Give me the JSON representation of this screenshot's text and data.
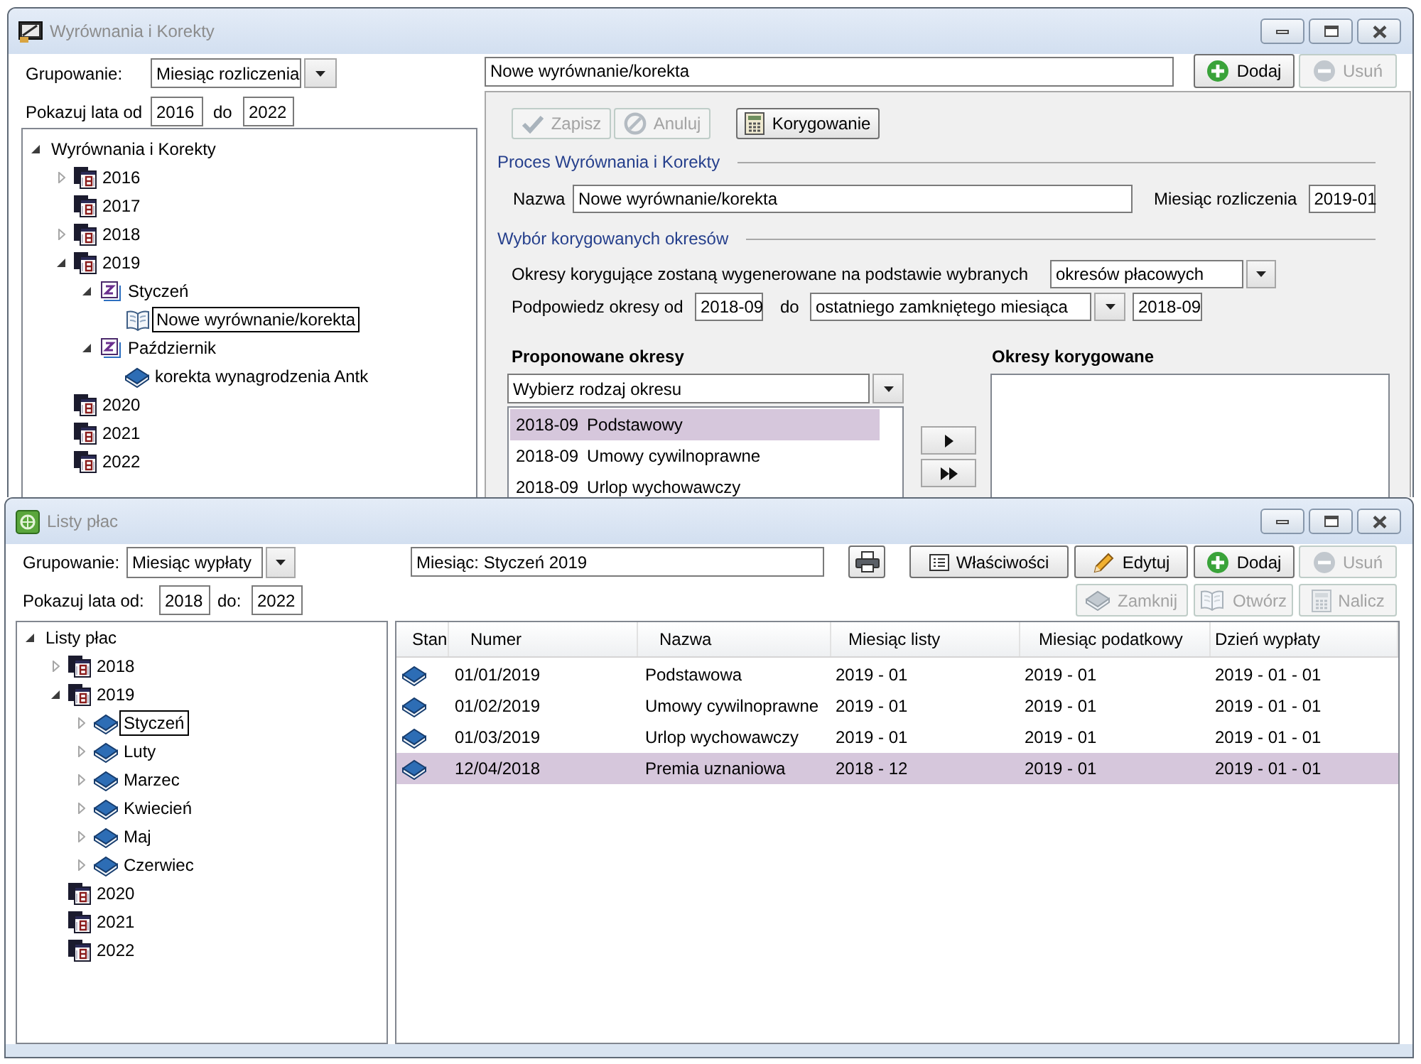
{
  "corrections_window": {
    "title": "Wyrównania i Korekty",
    "grouping": {
      "label": "Grupowanie:",
      "value": "Miesiąc rozliczenia"
    },
    "years": {
      "from_label": "Pokazuj lata od",
      "from": "2016",
      "to_label": "do",
      "to": "2022"
    },
    "tree": [
      {
        "label": "Wyrównania i Korekty",
        "expanded": true,
        "selected": false,
        "children": [
          {
            "label": "2016",
            "kind": "year",
            "expanded": false,
            "selected": false
          },
          {
            "label": "2017",
            "kind": "year",
            "selected": false
          },
          {
            "label": "2018",
            "kind": "year",
            "expanded": false,
            "selected": false
          },
          {
            "label": "2019",
            "kind": "year",
            "expanded": true,
            "selected": false,
            "children": [
              {
                "label": "Styczeń",
                "kind": "period",
                "expanded": true,
                "selected": false,
                "children": [
                  {
                    "label": "Nowe wyrównanie/korekta",
                    "kind": "draft",
                    "selected": true
                  }
                ]
              },
              {
                "label": "Październik",
                "kind": "period",
                "expanded": true,
                "selected": false,
                "children": [
                  {
                    "label": "korekta wynagrodzenia Antk",
                    "kind": "book",
                    "selected": false
                  }
                ]
              }
            ]
          },
          {
            "label": "2020",
            "kind": "year",
            "selected": false
          },
          {
            "label": "2021",
            "kind": "year",
            "selected": false
          },
          {
            "label": "2022",
            "kind": "year",
            "selected": false
          }
        ]
      }
    ],
    "name_field": "Nowe wyrównanie/korekta",
    "buttons": [
      {
        "label": "Dodaj",
        "kind": "add",
        "disabled": false
      },
      {
        "label": "Usuń",
        "kind": "remove",
        "disabled": true
      }
    ],
    "actions": [
      {
        "label": "Zapisz",
        "kind": "save",
        "disabled": true
      },
      {
        "label": "Anuluj",
        "kind": "cancel",
        "disabled": true
      },
      {
        "label": "Korygowanie",
        "kind": "correct",
        "disabled": false
      }
    ],
    "process": {
      "title": "Proces Wyrównania i Korekty",
      "name_label": "Nazwa",
      "name": "Nowe wyrównanie/korekta",
      "month_label": "Miesiąc rozliczenia",
      "month": "2019-01"
    },
    "periods": {
      "title": "Wybór korygowanych okresów",
      "basis_label": "Okresy korygujące zostaną wygenerowane na podstawie wybranych",
      "basis": "okresów płacowych",
      "hint_label": "Podpowiedz okresy od",
      "hint_from": "2018-09",
      "hint_to_label": "do",
      "hint_to": "ostatniego zamkniętego miesiąca",
      "hint_to_value": "2018-09"
    },
    "proposed": {
      "title": "Proponowane okresy",
      "type_select": "Wybierz rodzaj okresu",
      "items": [
        {
          "period": "2018-09",
          "name": "Podstawowy",
          "selected": true
        },
        {
          "period": "2018-09",
          "name": "Umowy cywilnoprawne",
          "selected": false
        },
        {
          "period": "2018-09",
          "name": "Urlop wychowawczy",
          "selected": false
        }
      ]
    },
    "move_buttons": [
      {
        "kind": "single"
      },
      {
        "kind": "all"
      }
    ],
    "corrected": {
      "title": "Okresy korygowane"
    }
  },
  "payroll_window": {
    "title": "Listy płac",
    "grouping": {
      "label": "Grupowanie:",
      "value": "Miesiąc wypłaty"
    },
    "years": {
      "from_label": "Pokazuj lata od:",
      "from": "2018",
      "to_label": "do:",
      "to": "2022"
    },
    "filter_field": "Miesiąc: Styczeń 2019",
    "toolbar": [
      {
        "label": "Właściwości",
        "kind": "properties",
        "disabled": false
      },
      {
        "label": "Edytuj",
        "kind": "edit",
        "disabled": false
      },
      {
        "label": "Dodaj",
        "kind": "add",
        "disabled": false
      },
      {
        "label": "Usuń",
        "kind": "remove",
        "disabled": true
      }
    ],
    "toolbar_row_2": [
      {
        "label": "Zamknij",
        "kind": "close",
        "disabled": true
      },
      {
        "label": "Otwórz",
        "kind": "open",
        "disabled": true
      },
      {
        "label": "Nalicz",
        "kind": "calculate",
        "disabled": true
      }
    ],
    "tree": [
      {
        "label": "Listy płac",
        "expanded": true,
        "selected": false,
        "children": [
          {
            "label": "2018",
            "kind": "year",
            "expanded": false,
            "selected": false
          },
          {
            "label": "2019",
            "kind": "year",
            "expanded": true,
            "selected": false,
            "children": [
              {
                "label": "Styczeń",
                "kind": "book",
                "expanded": false,
                "selected": true
              },
              {
                "label": "Luty",
                "kind": "book",
                "expanded": false,
                "selected": false
              },
              {
                "label": "Marzec",
                "kind": "book",
                "expanded": false,
                "selected": false
              },
              {
                "label": "Kwiecień",
                "kind": "book",
                "expanded": false,
                "selected": false
              },
              {
                "label": "Maj",
                "kind": "book",
                "expanded": false,
                "selected": false
              },
              {
                "label": "Czerwiec",
                "kind": "book",
                "expanded": false,
                "selected": false
              }
            ]
          },
          {
            "label": "2020",
            "kind": "year",
            "selected": false
          },
          {
            "label": "2021",
            "kind": "year",
            "selected": false
          },
          {
            "label": "2022",
            "kind": "year",
            "selected": false
          }
        ]
      }
    ],
    "table": {
      "columns": [
        "Stan",
        "Numer",
        "Nazwa",
        "Miesiąc listy",
        "Miesiąc podatkowy",
        "Dzień wypłaty"
      ],
      "rows": [
        {
          "cells": [
            "",
            "01/01/2019",
            "Podstawowa",
            "2019 - 01",
            "2019 - 01",
            "2019 - 01 - 01"
          ],
          "selected": false
        },
        {
          "cells": [
            "",
            "01/02/2019",
            "Umowy cywilnoprawne",
            "2019 - 01",
            "2019 - 01",
            "2019 - 01 - 01"
          ],
          "selected": false
        },
        {
          "cells": [
            "",
            "01/03/2019",
            "Urlop wychowawczy",
            "2019 - 01",
            "2019 - 01",
            "2019 - 01 - 01"
          ],
          "selected": false
        },
        {
          "cells": [
            "",
            "12/04/2018",
            "Premia uznaniowa",
            "2018 - 12",
            "2019 - 01",
            "2019 - 01 - 01"
          ],
          "selected": true
        }
      ]
    }
  }
}
